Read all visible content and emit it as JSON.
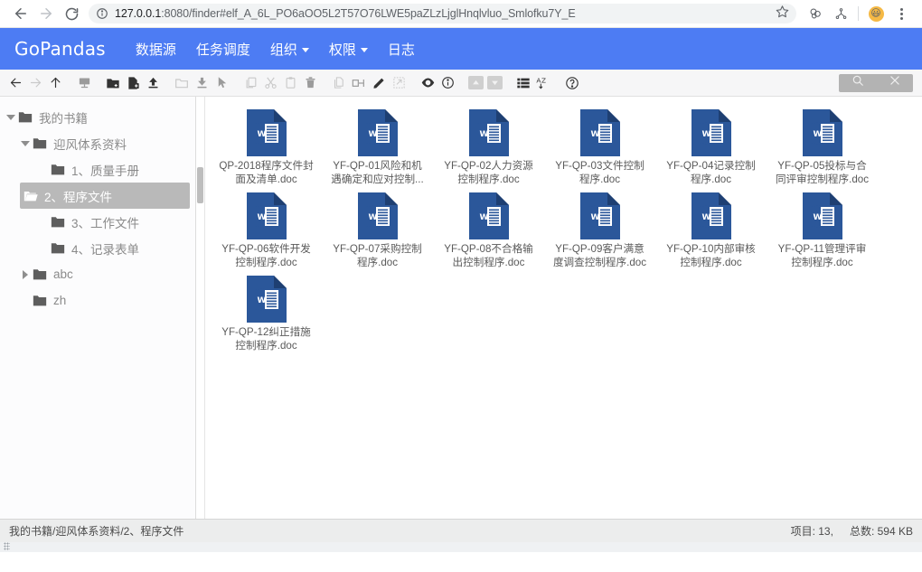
{
  "browser": {
    "url_prefix": "127.0.0.1",
    "url_rest": ":8080/finder#elf_A_6L_PO6aOO5L2T57O76LWE5paZLzLjglHnqlvluo_Smlofku7Y_E",
    "back_icon": "back-arrow-icon",
    "forward_icon": "forward-arrow-icon",
    "reload_icon": "reload-icon",
    "info_icon": "site-info-icon",
    "star_icon": "bookmark-star-icon",
    "extension_icon": "extensions-icon",
    "profile_icon": "profile-avatar-icon",
    "menu_icon": "chrome-menu-icon",
    "avatar_glyph": "😃"
  },
  "app_nav": {
    "brand": "GoPandas",
    "items": [
      {
        "label": "数据源",
        "has_caret": false
      },
      {
        "label": "任务调度",
        "has_caret": false
      },
      {
        "label": "组织",
        "has_caret": true
      },
      {
        "label": "权限",
        "has_caret": true
      },
      {
        "label": "日志",
        "has_caret": false
      }
    ],
    "accent_color": "#4d7cf3"
  },
  "toolbar": {
    "icons": [
      "back-icon",
      "forward-icon",
      "up-icon",
      "home-network-icon",
      "new-folder-icon",
      "new-file-icon",
      "upload-icon",
      "open-folder-icon",
      "download-icon",
      "select-cursor-icon",
      "copy-icon",
      "cut-icon",
      "paste-icon",
      "delete-icon",
      "duplicate-icon",
      "rename-icon",
      "edit-pencil-icon",
      "extract-icon",
      "preview-eye-icon",
      "info-icon",
      "move-up-icon",
      "move-down-icon",
      "list-view-icon",
      "sort-az-icon",
      "help-icon"
    ],
    "search_icon": "search-icon",
    "close_icon": "close-icon"
  },
  "sidebar": {
    "items": [
      {
        "label": "我的书籍",
        "level": 1,
        "twisty": "down",
        "selected": false
      },
      {
        "label": "迎风体系资料",
        "level": 2,
        "twisty": "down",
        "selected": false
      },
      {
        "label": "1、质量手册",
        "level": 3,
        "twisty": "none",
        "selected": false
      },
      {
        "label": "2、程序文件",
        "level": 3,
        "twisty": "none",
        "selected": true
      },
      {
        "label": "3、工作文件",
        "level": 3,
        "twisty": "none",
        "selected": false
      },
      {
        "label": "4、记录表单",
        "level": 3,
        "twisty": "none",
        "selected": false
      },
      {
        "label": "abc",
        "level": 2,
        "twisty": "right",
        "selected": false
      },
      {
        "label": "zh",
        "level": 2,
        "twisty": "none",
        "selected": false
      }
    ]
  },
  "files": [
    {
      "line1": "QP-2018程序文件封",
      "line2": "面及清单.doc",
      "type": "word-doc"
    },
    {
      "line1": "YF-QP-01风险和机",
      "line2": "遇确定和应对控制...",
      "type": "word-doc"
    },
    {
      "line1": "YF-QP-02人力资源",
      "line2": "控制程序.doc",
      "type": "word-doc"
    },
    {
      "line1": "YF-QP-03文件控制",
      "line2": "程序.doc",
      "type": "word-doc"
    },
    {
      "line1": "YF-QP-04记录控制",
      "line2": "程序.doc",
      "type": "word-doc"
    },
    {
      "line1": "YF-QP-05投标与合",
      "line2": "同评审控制程序.doc",
      "type": "word-doc"
    },
    {
      "line1": "YF-QP-06软件开发",
      "line2": "控制程序.doc",
      "type": "word-doc"
    },
    {
      "line1": "YF-QP-07采购控制",
      "line2": "程序.doc",
      "type": "word-doc"
    },
    {
      "line1": "YF-QP-08不合格输",
      "line2": "出控制程序.doc",
      "type": "word-doc"
    },
    {
      "line1": "YF-QP-09客户满意",
      "line2": "度调查控制程序.doc",
      "type": "word-doc"
    },
    {
      "line1": "YF-QP-10内部审核",
      "line2": "控制程序.doc",
      "type": "word-doc"
    },
    {
      "line1": "YF-QP-11管理评审",
      "line2": "控制程序.doc",
      "type": "word-doc"
    },
    {
      "line1": "YF-QP-12纠正措施",
      "line2": "控制程序.doc",
      "type": "word-doc"
    }
  ],
  "status": {
    "path": "我的书籍/迎风体系资料/2、程序文件",
    "items": "项目: 13,",
    "total": "总数: 594 KB"
  }
}
